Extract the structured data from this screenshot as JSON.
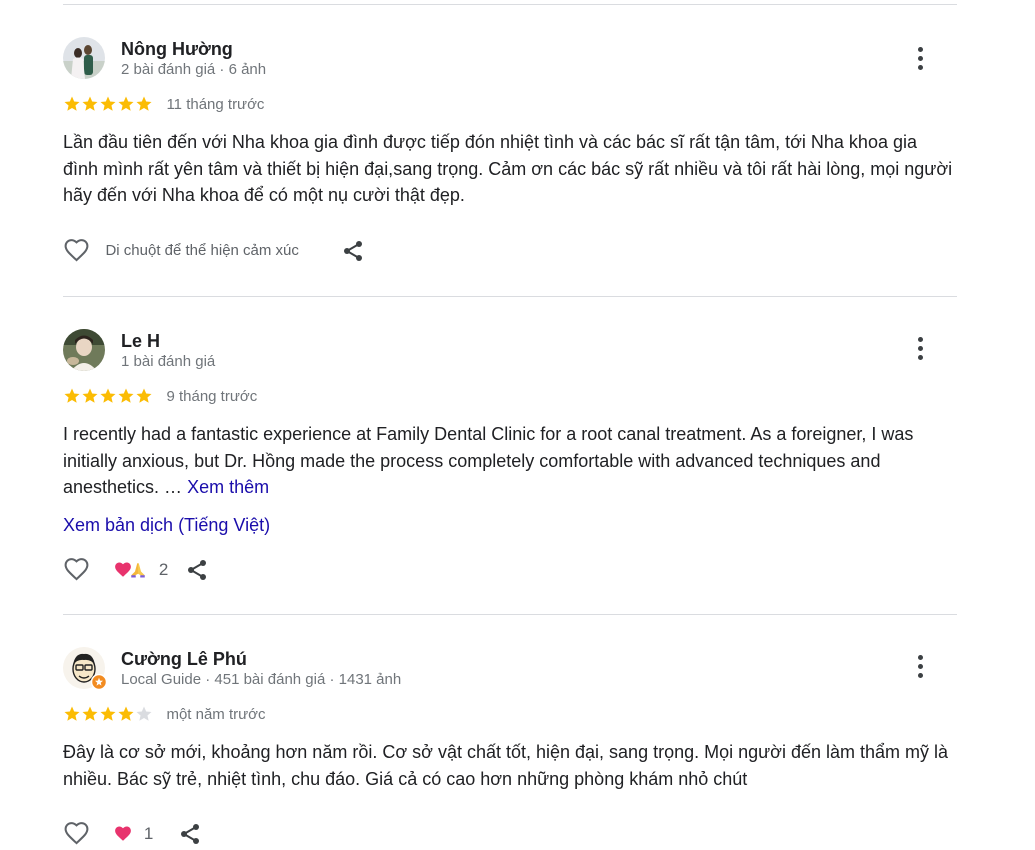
{
  "reviews": [
    {
      "name": "Nông Hường",
      "meta": "2 bài đánh giá · 6 ảnh",
      "rating": 5,
      "time": "11 tháng trước",
      "text": "Lần đầu tiên đến với Nha khoa gia đình được tiếp đón nhiệt tình và các bác sĩ rất tận tâm, tới Nha khoa gia đình mình rất yên tâm và thiết bị hiện đại,sang trọng. Cảm ơn các bác sỹ rất nhiều và tôi rất hài lòng, mọi người hãy đến với Nha khoa để có một nụ cười thật đẹp.",
      "reaction_hint": "Di chuột để thể hiện cảm xúc"
    },
    {
      "name": "Le H",
      "meta": "1 bài đánh giá",
      "rating": 5,
      "time": "9 tháng trước",
      "text": "I recently had a fantastic experience at Family Dental Clinic for a root canal treatment. As a foreigner, I was initially anxious, but Dr. Hồng made the process completely comfortable with advanced techniques and anesthetics. …",
      "more_label": "Xem thêm",
      "translate_label": "Xem bản dịch (Tiếng Việt)",
      "reaction_count": "2"
    },
    {
      "name": "Cường Lê Phú",
      "meta": "Local Guide · 451 bài đánh giá · 1431 ảnh",
      "rating": 4,
      "time": "một năm trước",
      "text": "Đây là cơ sở mới, khoảng hơn năm rồi. Cơ sở vật chất tốt, hiện đại, sang trọng. Mọi người đến làm thẩm mỹ là nhiều. Bác sỹ trẻ, nhiệt tình, chu đáo. Giá cả có cao hơn những phòng khám nhỏ chút",
      "reaction_count": "1"
    }
  ],
  "colors": {
    "star_filled": "#fbbc04",
    "star_empty": "#dadce0",
    "link": "#1a0dab",
    "secondary_text": "#70757a"
  },
  "icons": [
    "more-vert-icon",
    "star-icon",
    "heart-outline-icon",
    "share-icon",
    "heart-emoji-icon",
    "praying-hands-emoji-icon",
    "local-guide-badge-icon"
  ]
}
